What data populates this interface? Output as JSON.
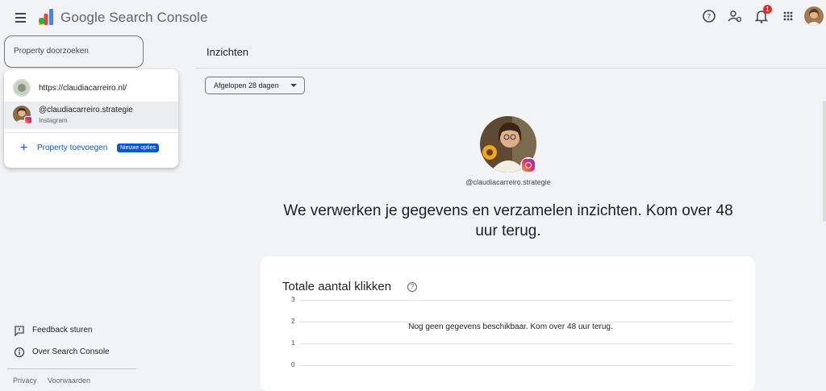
{
  "header": {
    "app_title": "Google Search Console",
    "notification_count": "1",
    "icons": [
      "menu-icon",
      "help-icon",
      "manage-users-icon",
      "notifications-icon",
      "apps-icon",
      "account-avatar"
    ]
  },
  "sidebar": {
    "search_placeholder": "Property doorzoeken",
    "properties": [
      {
        "label": "https://claudiacarreiro.nl/"
      },
      {
        "label": "@claudiacarreiro.strategie",
        "sub": "Instagram"
      }
    ],
    "add_property": "Property toevoegen",
    "new_badge": "Nieuwe opties",
    "links": [
      {
        "label": "Feedback sturen",
        "icon": "feedback-icon"
      },
      {
        "label": "Over Search Console",
        "icon": "info-icon"
      }
    ],
    "footer": {
      "privacy": "Privacy",
      "terms": "Voorwaarden"
    }
  },
  "main": {
    "page_title": "Inzichten",
    "date_range": "Afgelopen 28 dagen",
    "handle": "@claudiacarreiro.strategie",
    "headline": "We verwerken je gegevens en verzamelen inzichten. Kom over 48 uur terug.",
    "card": {
      "title": "Totale aantal klikken",
      "no_data": "Nog geen gegevens beschikbaar. Kom over 48 uur terug."
    }
  },
  "chart_data": {
    "type": "line",
    "title": "Totale aantal klikken",
    "y_ticks": [
      "3",
      "2",
      "1",
      "0"
    ],
    "ylim": [
      0,
      3
    ],
    "series": [],
    "grid": true
  },
  "colors": {
    "accent": "#0b57d0",
    "background": "#f1f3f6",
    "badge": "#d93025"
  }
}
